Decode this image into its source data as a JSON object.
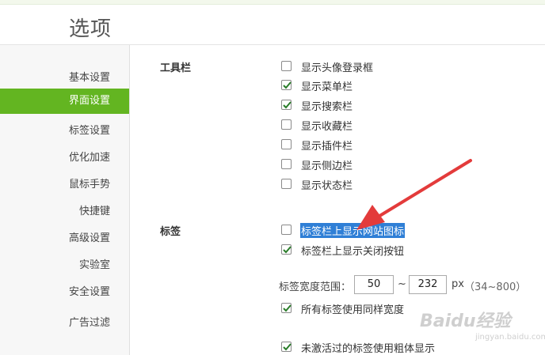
{
  "page": {
    "title": "选项"
  },
  "sidebar": {
    "items": [
      {
        "label": "基本设置",
        "active": false
      },
      {
        "label": "界面设置",
        "active": true
      },
      {
        "label": "标签设置",
        "active": false
      },
      {
        "label": "优化加速",
        "active": false
      },
      {
        "label": "鼠标手势",
        "active": false
      },
      {
        "label": "快捷键",
        "active": false
      },
      {
        "label": "高级设置",
        "active": false
      },
      {
        "label": "实验室",
        "active": false
      },
      {
        "label": "安全设置",
        "active": false
      },
      {
        "label": "广告过滤",
        "active": false
      }
    ],
    "accent_color": "#63b521"
  },
  "toolbar_section": {
    "label": "工具栏",
    "options": [
      {
        "label": "显示头像登录框",
        "checked": false
      },
      {
        "label": "显示菜单栏",
        "checked": true
      },
      {
        "label": "显示搜索栏",
        "checked": true
      },
      {
        "label": "显示收藏栏",
        "checked": false
      },
      {
        "label": "显示插件栏",
        "checked": false
      },
      {
        "label": "显示侧边栏",
        "checked": false
      },
      {
        "label": "显示状态栏",
        "checked": false
      }
    ]
  },
  "tabs_section": {
    "label": "标签",
    "options": [
      {
        "label": "标签栏上显示网站图标",
        "checked": false,
        "selected": true
      },
      {
        "label": "标签栏上显示关闭按钮",
        "checked": true
      }
    ],
    "width_range": {
      "label": "标签宽度范围：",
      "min": "50",
      "separator": "~",
      "max": "232",
      "unit": "px",
      "hint": "（34~800）"
    },
    "same_width": {
      "label": "所有标签使用同样宽度",
      "checked": true
    },
    "bold_inactive": {
      "label": "未激活过的标签使用粗体显示",
      "checked": true
    }
  },
  "watermark": {
    "text": "Baidu经验",
    "sub": "jingyan.baidu.com"
  },
  "icons": {
    "check": "check-icon",
    "arrow": "annotation-arrow-icon"
  },
  "colors": {
    "check": "#2a7d2a",
    "selection": "#2f7fd6",
    "arrow": "#e33b3b"
  }
}
